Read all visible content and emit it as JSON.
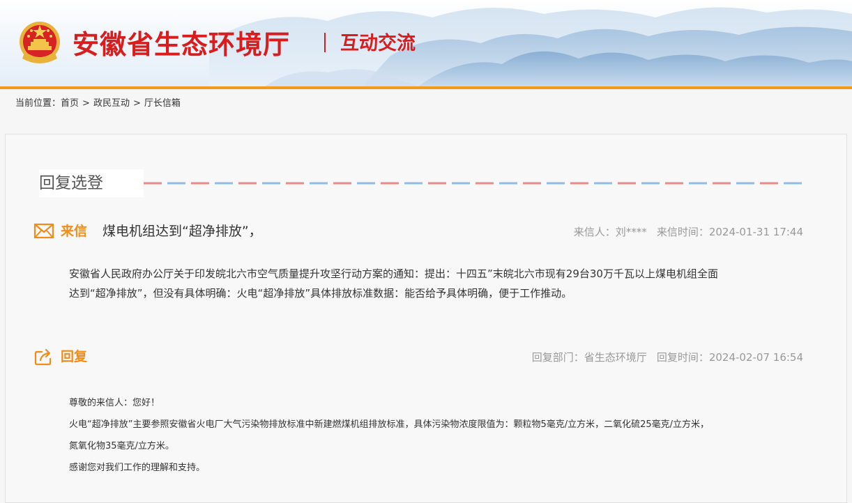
{
  "header": {
    "site_title": "安徽省生态环境厅",
    "section_title": "互动交流"
  },
  "breadcrumb": {
    "label": "当前位置：",
    "items": [
      "首页",
      "政民互动",
      "厅长信箱"
    ],
    "separator": ">"
  },
  "panel": {
    "heading": "回复选登"
  },
  "letter": {
    "label": "来信",
    "subject": "煤电机组达到“超净排放”，",
    "sender_label": "来信人：",
    "sender": "刘****",
    "time_label": "来信时间：",
    "time": "2024-01-31 17:44",
    "body": [
      "安徽省人民政府办公厅关于印发皖北六市空气质量提升攻坚行动方案的通知：提出：十四五”末皖北六市现有29台30万千瓦以上煤电机组全面",
      "达到“超净排放”，但没有具体明确：火电“超净排放”具体排放标准数据：能否给予具体明确，便于工作推动。"
    ]
  },
  "reply": {
    "label": "回复",
    "dept_label": "回复部门：",
    "dept": "省生态环境厅",
    "time_label": "回复时间：",
    "time": "2024-02-07 16:54",
    "body": [
      "尊敬的来信人：您好！",
      "火电“超净排放”主要参照安徽省火电厂大气污染物排放标准中新建燃煤机组排放标准，具体污染物浓度限值为：颗粒物5毫克/立方米，二氧化硫25毫克/立方米，",
      "氮氧化物35毫克/立方米。",
      "感谢您对我们工作的理解和支持。"
    ]
  },
  "colors": {
    "title_red": "#d71d1d",
    "accent_orange": "#f08c1a",
    "bar_orange": "#f39a1b",
    "dash_red": "#e68a8a",
    "dash_blue": "#8fbbe6",
    "meta_gray": "#999999"
  },
  "icons": {
    "emblem": "national-emblem-icon",
    "letter": "envelope-icon",
    "reply": "share-reply-icon"
  }
}
